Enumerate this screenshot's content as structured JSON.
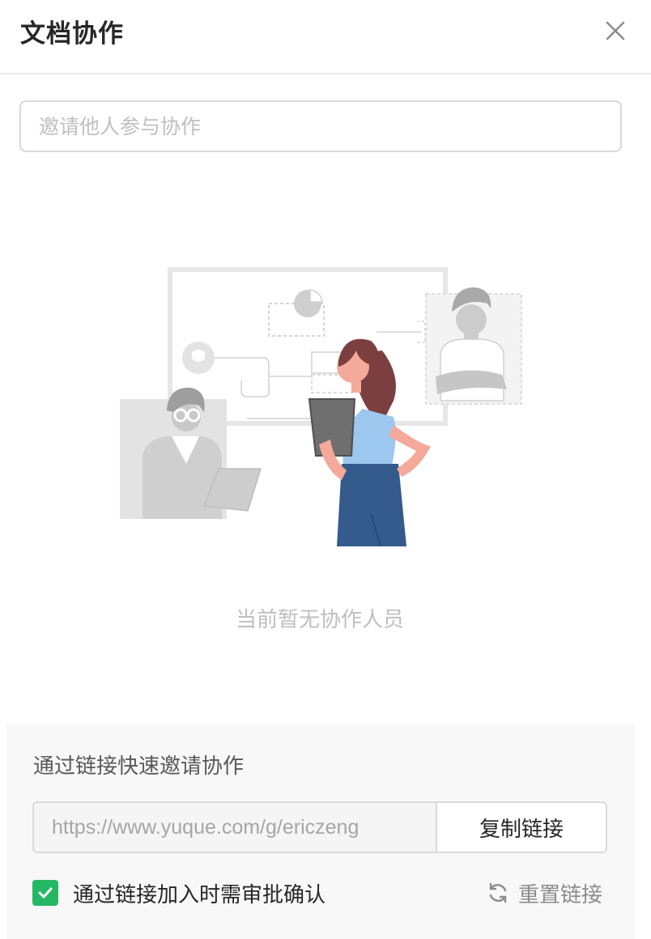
{
  "dialog": {
    "title": "文档协作"
  },
  "invite": {
    "placeholder": "邀请他人参与协作"
  },
  "empty_state": {
    "text": "当前暂无协作人员"
  },
  "link_panel": {
    "title": "通过链接快速邀请协作",
    "url": "https://www.yuque.com/g/ericzeng",
    "copy_label": "复制链接",
    "approval_label": "通过链接加入时需审批确认",
    "approval_checked": true,
    "reset_label": "重置链接"
  },
  "colors": {
    "accent": "#25b864",
    "hair": "#7b3f3f",
    "shirt": "#9cc7ee",
    "skirt": "#355a8c"
  },
  "icons": [
    "close-icon",
    "check-icon",
    "refresh-icon"
  ]
}
